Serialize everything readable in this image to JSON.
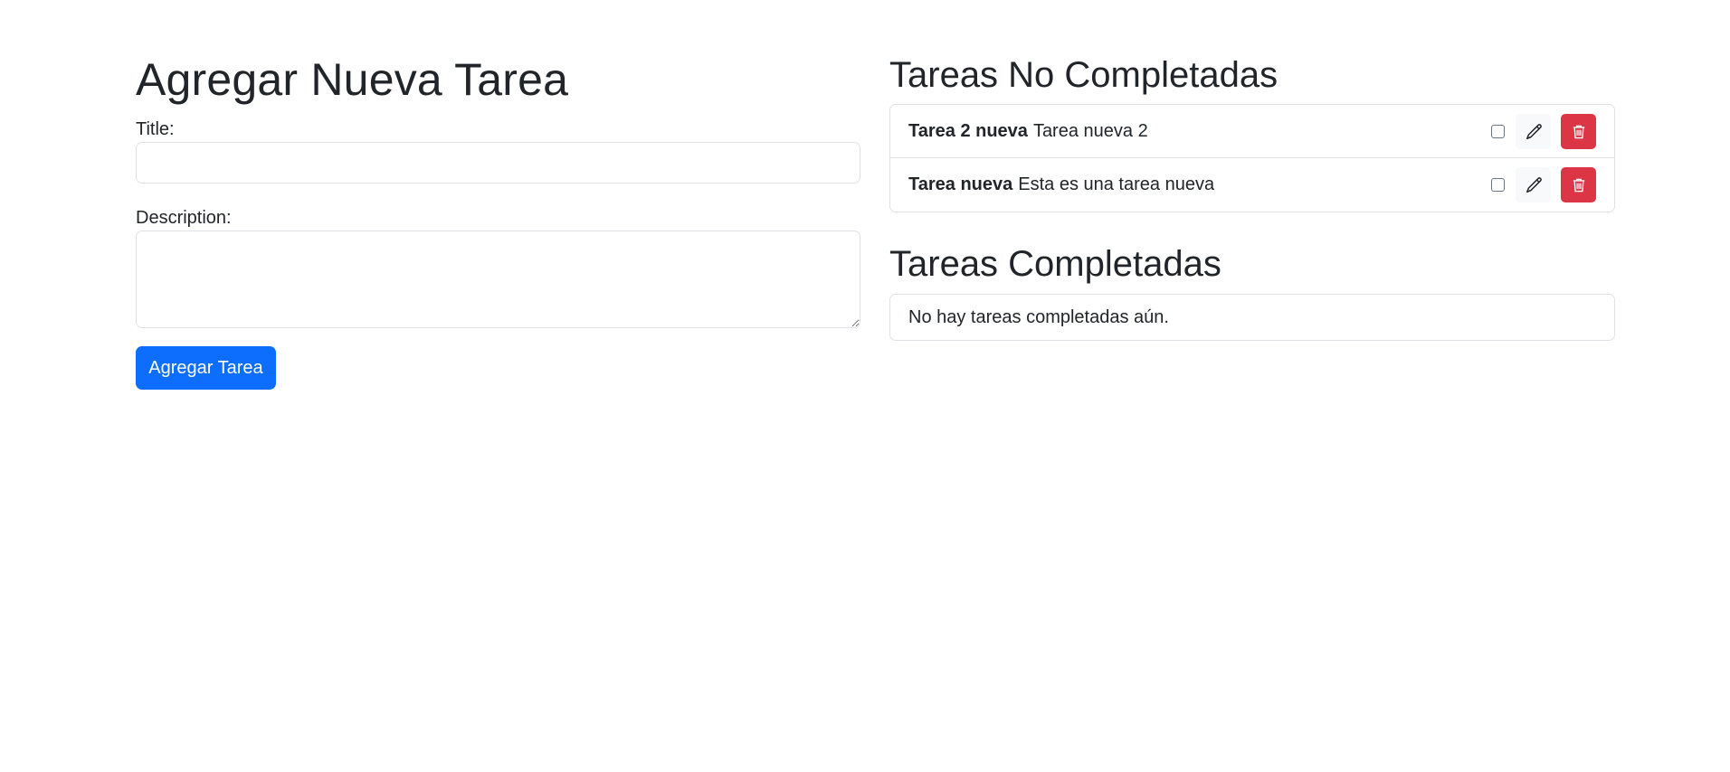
{
  "form": {
    "heading": "Agregar Nueva Tarea",
    "title_label": "Title:",
    "title_value": "",
    "description_label": "Description:",
    "description_value": "",
    "submit_label": "Agregar Tarea"
  },
  "pending": {
    "heading": "Tareas No Completadas",
    "tasks": [
      {
        "title": "Tarea 2 nueva",
        "description": "Tarea nueva 2",
        "completed": false
      },
      {
        "title": "Tarea nueva",
        "description": "Esta es una tarea nueva",
        "completed": false
      }
    ]
  },
  "completed": {
    "heading": "Tareas Completadas",
    "empty_message": "No hay tareas completadas aún."
  },
  "icons": {
    "edit": "pencil-icon",
    "delete": "trash-icon"
  },
  "colors": {
    "primary": "#0d6efd",
    "danger": "#dc3545",
    "light": "#f8f9fa",
    "text": "#212529",
    "border": "#dee2e6"
  }
}
